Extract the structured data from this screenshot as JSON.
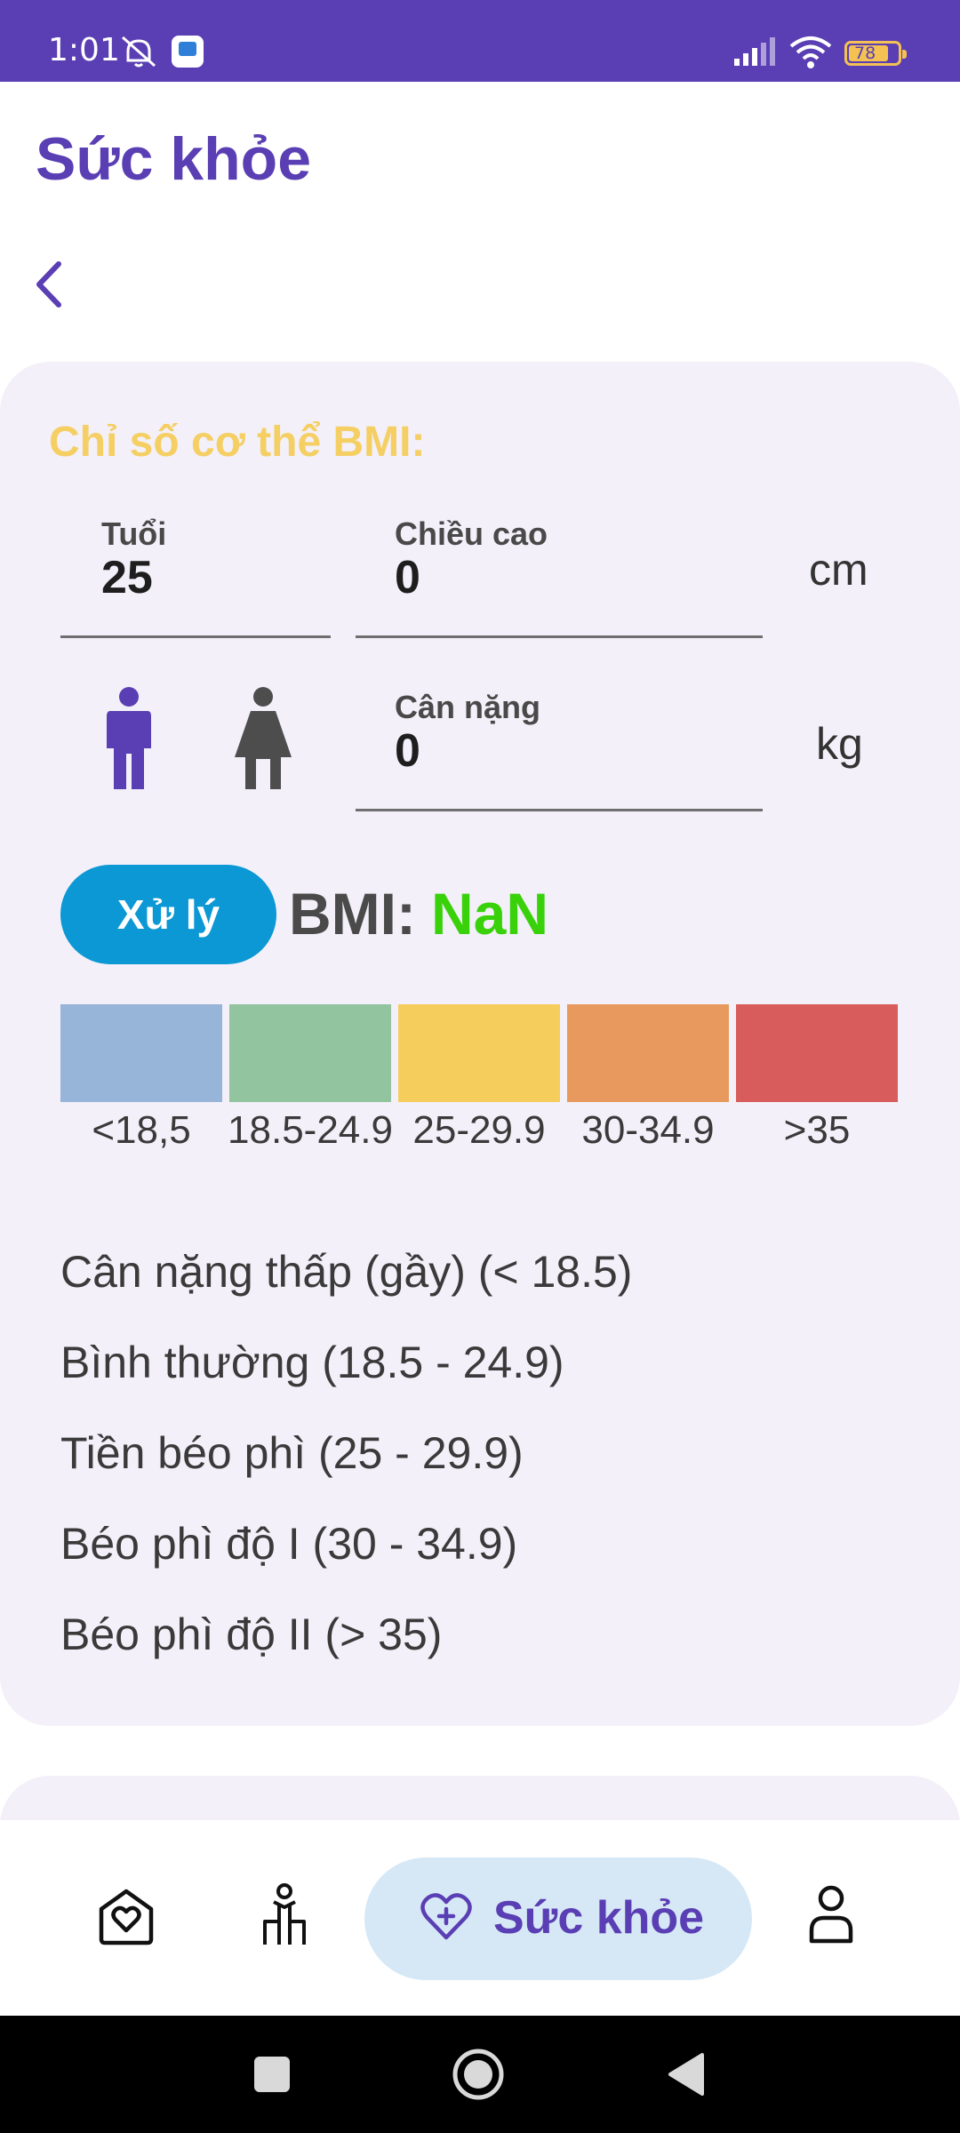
{
  "status_bar": {
    "time": "1:01",
    "battery": "78",
    "icons": [
      "mute-icon",
      "app-notification-icon",
      "signal-icon",
      "wifi-icon",
      "battery-icon"
    ]
  },
  "header": {
    "title": "Sức khỏe",
    "back_icon": "chevron-left-icon"
  },
  "bmi": {
    "section_title": "Chỉ số cơ thể BMI:",
    "age": {
      "label": "Tuổi",
      "value": "25"
    },
    "height": {
      "label": "Chiều cao",
      "value": "0",
      "unit": "cm"
    },
    "weight": {
      "label": "Cân nặng",
      "value": "0",
      "unit": "kg"
    },
    "gender_icons": [
      "male-icon",
      "female-icon"
    ],
    "gender_selected": "male",
    "process_button": "Xử lý",
    "result_label": "BMI:",
    "result_value": "NaN",
    "scale": [
      {
        "label": "<18,5",
        "color": "#97b4d9"
      },
      {
        "label": "18.5-24.9",
        "color": "#92c59f"
      },
      {
        "label": "25-29.9",
        "color": "#f4cd5d"
      },
      {
        "label": "30-34.9",
        "color": "#e89a5e"
      },
      {
        "label": ">35",
        "color": "#d95c5c"
      }
    ],
    "categories": [
      "Cân nặng thấp (gầy) (< 18.5)",
      "Bình thường (18.5 - 24.9)",
      "Tiền béo phì (25 - 29.9)",
      "Béo phì độ I (30 - 34.9)",
      "Béo phì độ II (> 35)"
    ]
  },
  "bottom_nav": {
    "items": [
      {
        "icon": "home-heart-icon",
        "label": ""
      },
      {
        "icon": "exercise-icon",
        "label": ""
      },
      {
        "icon": "heart-plus-icon",
        "label": "Sức khỏe",
        "active": true
      },
      {
        "icon": "person-icon",
        "label": ""
      }
    ]
  },
  "colors": {
    "primary": "#5a3eb3",
    "accent_yellow": "#f5cf63",
    "button_blue": "#0b98d4",
    "bmi_value_green": "#39d10a",
    "card_bg": "#f3f0f9",
    "nav_active_bg": "#d6e8f6"
  }
}
